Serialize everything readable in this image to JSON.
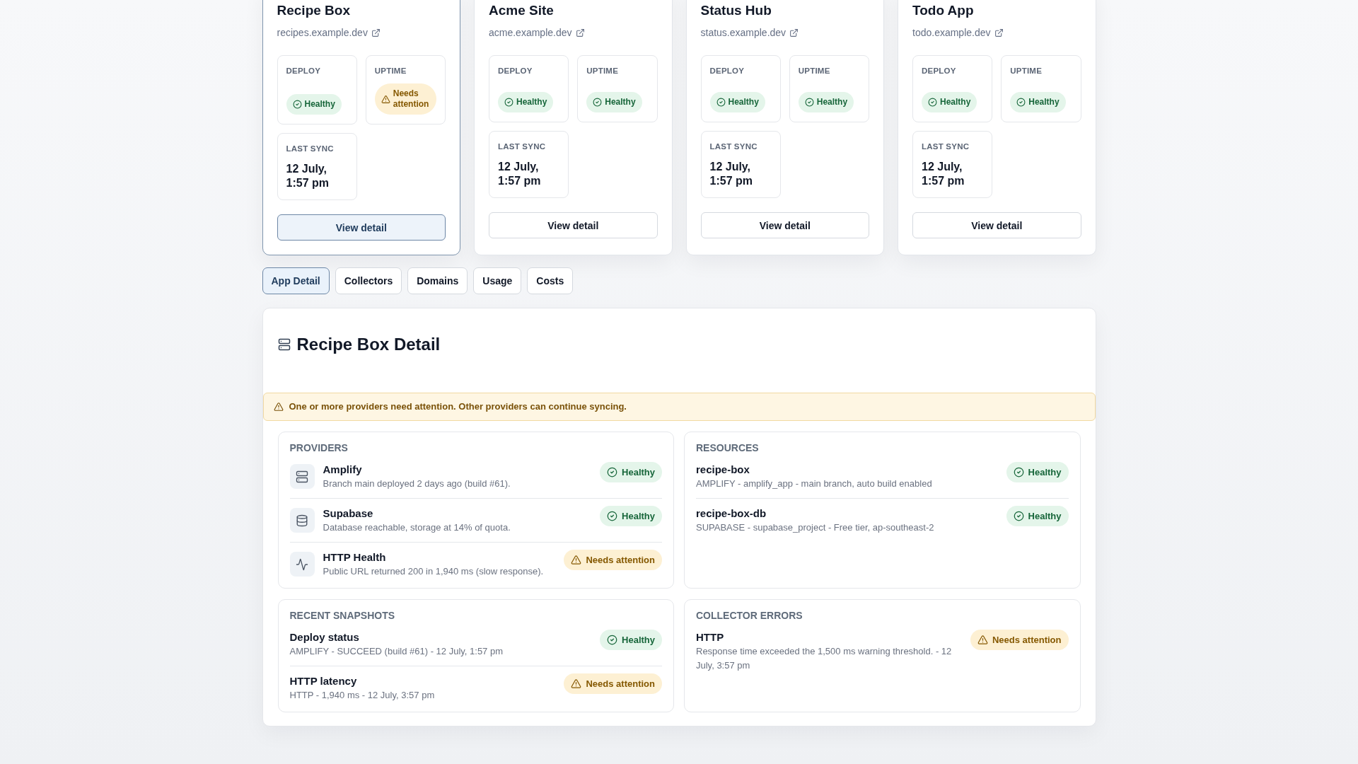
{
  "apps": [
    {
      "name": "Recipe Box",
      "url": "recipes.example.dev",
      "selected": true,
      "metrics": [
        {
          "kind": "status",
          "label": "DEPLOY",
          "needs_attention": false,
          "value": "Healthy"
        },
        {
          "kind": "status",
          "label": "UPTIME",
          "needs_attention": true,
          "value": "Needs attention"
        },
        {
          "kind": "text",
          "label": "LAST SYNC",
          "value": "12 July, 1:57 pm"
        }
      ],
      "button": "View detail"
    },
    {
      "name": "Acme Site",
      "url": "acme.example.dev",
      "selected": false,
      "metrics": [
        {
          "kind": "status",
          "label": "DEPLOY",
          "needs_attention": false,
          "value": "Healthy"
        },
        {
          "kind": "status",
          "label": "UPTIME",
          "needs_attention": false,
          "value": "Healthy"
        },
        {
          "kind": "text",
          "label": "LAST SYNC",
          "value": "12 July, 1:57 pm"
        }
      ],
      "button": "View detail"
    },
    {
      "name": "Status Hub",
      "url": "status.example.dev",
      "selected": false,
      "metrics": [
        {
          "kind": "status",
          "label": "DEPLOY",
          "needs_attention": false,
          "value": "Healthy"
        },
        {
          "kind": "status",
          "label": "UPTIME",
          "needs_attention": false,
          "value": "Healthy"
        },
        {
          "kind": "text",
          "label": "LAST SYNC",
          "value": "12 July, 1:57 pm"
        }
      ],
      "button": "View detail"
    },
    {
      "name": "Todo App",
      "url": "todo.example.dev",
      "selected": false,
      "metrics": [
        {
          "kind": "status",
          "label": "DEPLOY",
          "needs_attention": false,
          "value": "Healthy"
        },
        {
          "kind": "status",
          "label": "UPTIME",
          "needs_attention": false,
          "value": "Healthy"
        },
        {
          "kind": "text",
          "label": "LAST SYNC",
          "value": "12 July, 1:57 pm"
        }
      ],
      "button": "View detail"
    }
  ],
  "tabs": [
    {
      "label": "App Detail",
      "selected": true
    },
    {
      "label": "Collectors",
      "selected": false
    },
    {
      "label": "Domains",
      "selected": false
    },
    {
      "label": "Usage",
      "selected": false
    },
    {
      "label": "Costs",
      "selected": false
    }
  ],
  "detail": {
    "title": "Recipe Box Detail",
    "alert": "One or more providers need attention. Other providers can continue syncing.",
    "sections": [
      {
        "title": "PROVIDERS",
        "items": [
          {
            "kind": "hosting",
            "name": "Amplify",
            "description": "Branch main deployed 2 days ago (build #61).",
            "needs_attention": false,
            "badge": "Healthy"
          },
          {
            "kind": "database",
            "name": "Supabase",
            "description": "Database reachable, storage at 14% of quota.",
            "needs_attention": false,
            "badge": "Healthy"
          },
          {
            "kind": "http",
            "name": "HTTP Health",
            "description": "Public URL returned 200 in 1,940 ms (slow response).",
            "needs_attention": true,
            "badge": "Needs attention"
          }
        ]
      },
      {
        "title": "RESOURCES",
        "items": [
          {
            "name": "recipe-box",
            "description": "AMPLIFY - amplify_app - main branch, auto build enabled",
            "needs_attention": false,
            "badge": "Healthy"
          },
          {
            "name": "recipe-box-db",
            "description": "SUPABASE - supabase_project - Free tier, ap-southeast-2",
            "needs_attention": false,
            "badge": "Healthy"
          }
        ]
      },
      {
        "title": "RECENT SNAPSHOTS",
        "items": [
          {
            "name": "Deploy status",
            "description": "AMPLIFY - SUCCEED (build #61) - 12 July, 1:57 pm",
            "needs_attention": false,
            "badge": "Healthy"
          },
          {
            "name": "HTTP latency",
            "description": "HTTP - 1,940 ms - 12 July, 3:57 pm",
            "needs_attention": true,
            "badge": "Needs attention"
          }
        ]
      },
      {
        "title": "COLLECTOR ERRORS",
        "items": [
          {
            "name": "HTTP",
            "description": "Response time exceeded the 1,500 ms warning threshold. - 12 July, 3:57 pm",
            "needs_attention": true,
            "badge": "Needs attention"
          }
        ]
      }
    ]
  }
}
